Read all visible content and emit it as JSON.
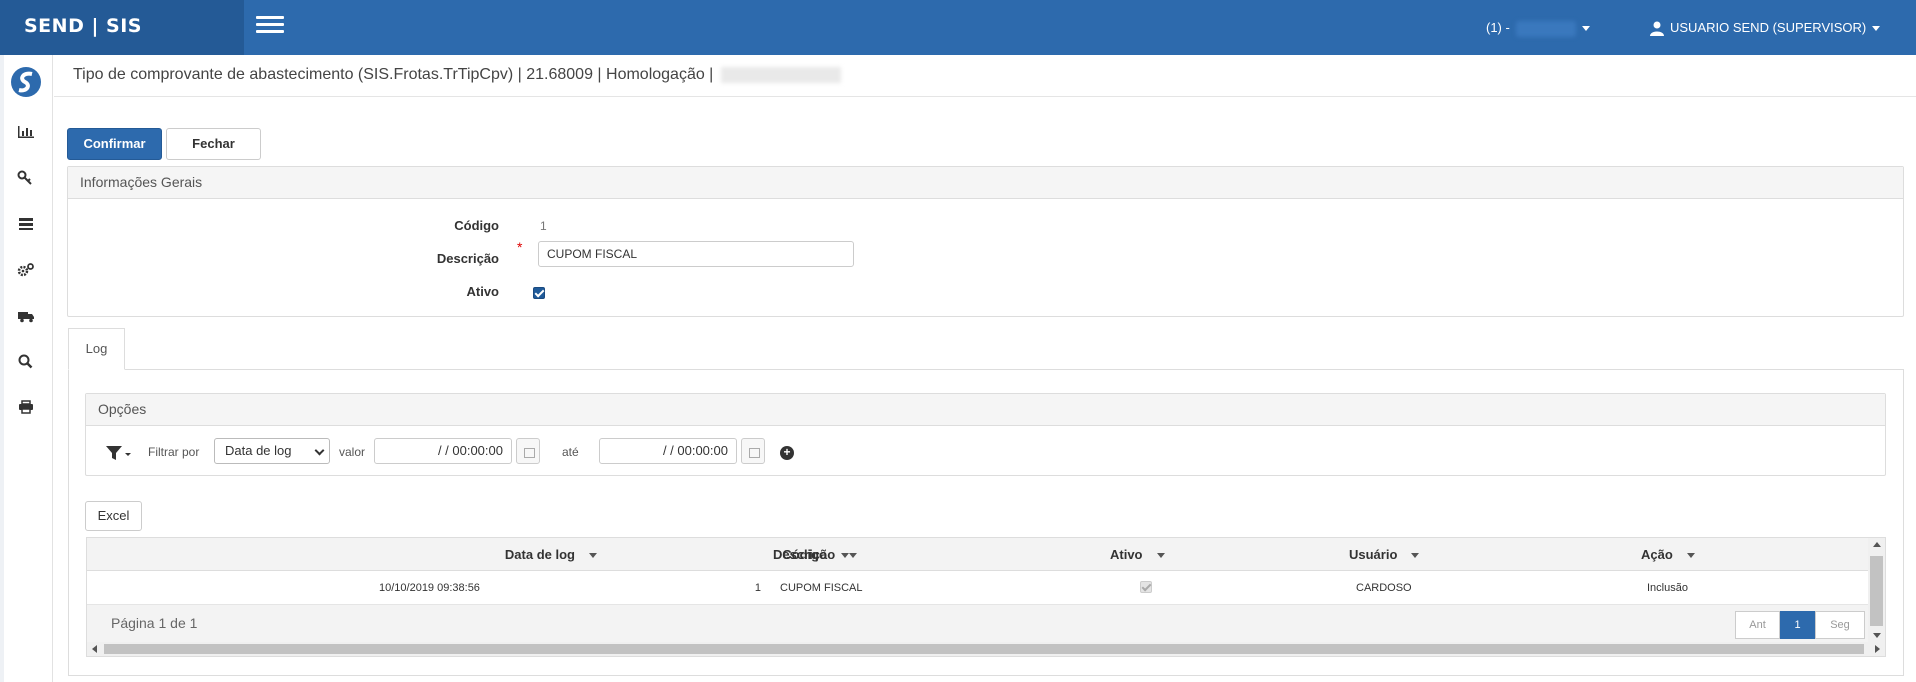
{
  "app": {
    "brand": "SEND | SIS"
  },
  "header": {
    "company_label": "(1) -",
    "user_label": "USUARIO SEND (SUPERVISOR)"
  },
  "sidebar": {
    "icons": [
      "chart-icon",
      "key-icon",
      "list-icon",
      "settings-icon",
      "truck-icon",
      "search-icon",
      "print-icon"
    ]
  },
  "page": {
    "title": "Tipo de comprovante de abastecimento (SIS.Frotas.TrTipCpv) | 21.68009 | Homologação |"
  },
  "toolbar": {
    "confirm_label": "Confirmar",
    "close_label": "Fechar"
  },
  "general": {
    "heading": "Informações Gerais",
    "codigo_label": "Código",
    "codigo_value": "1",
    "descricao_label": "Descrição",
    "descricao_value": "CUPOM FISCAL",
    "required_mark": "*",
    "ativo_label": "Ativo",
    "ativo_checked": true
  },
  "tabs": [
    {
      "label": "Log"
    }
  ],
  "options": {
    "heading": "Opções",
    "filter_by_label": "Filtrar por",
    "filter_field": "Data de log",
    "valor_label": "valor",
    "from_value": "/ /     00:00:00",
    "ate_label": "até",
    "to_value": "/ /     00:00:00",
    "add_symbol": "+"
  },
  "excel_label": "Excel",
  "grid": {
    "columns": [
      "Data de log",
      "Código",
      "Descrição",
      "Ativo",
      "Usuário",
      "Ação"
    ],
    "rows": [
      {
        "data_log": "10/10/2019 09:38:56",
        "codigo": "1",
        "descricao": "CUPOM FISCAL",
        "ativo": true,
        "usuario": "CARDOSO",
        "acao": "Inclusão"
      }
    ],
    "page_info": "Página 1 de 1",
    "pager": {
      "prev": "Ant",
      "current": "1",
      "next": "Seg"
    }
  },
  "colors": {
    "primary": "#2d6aad",
    "brand_bg": "#245a96"
  }
}
